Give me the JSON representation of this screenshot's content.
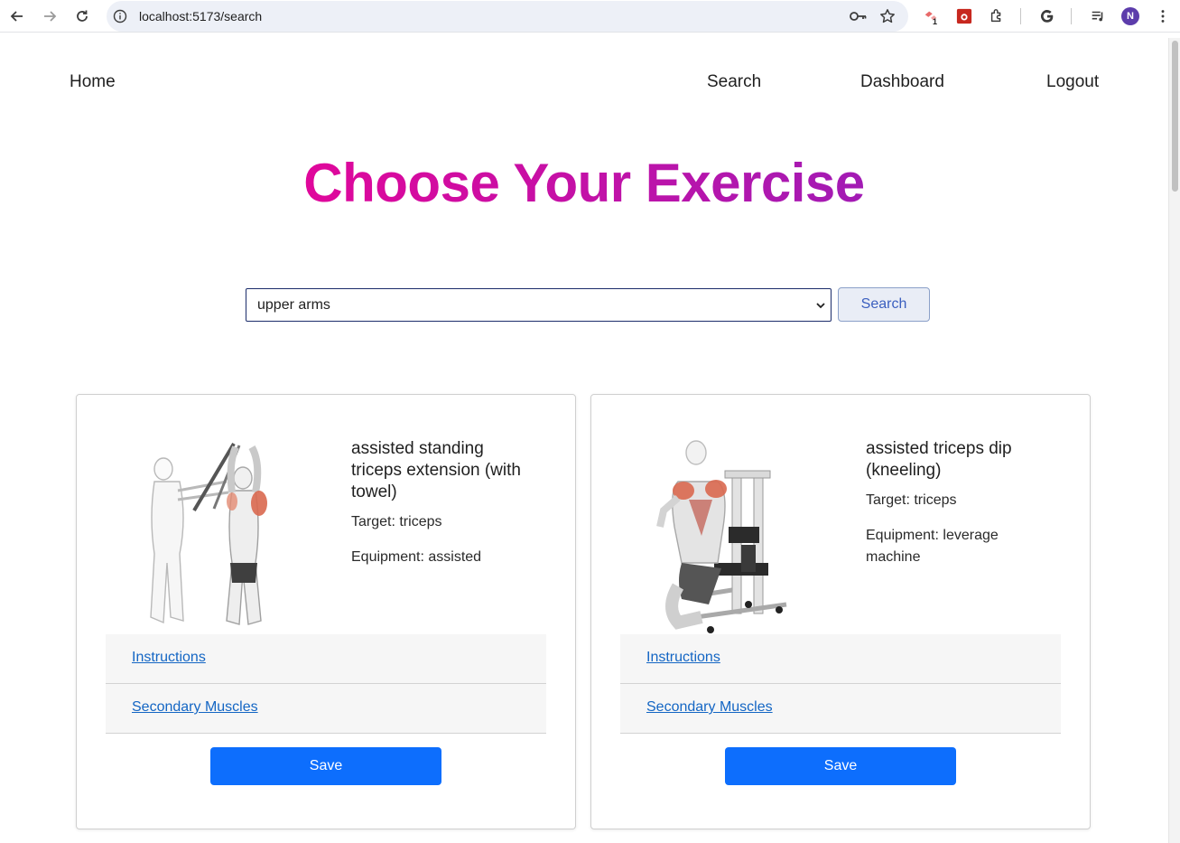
{
  "browser": {
    "url": "localhost:5173/search",
    "extension_badge": "1",
    "profile_initial": "N"
  },
  "nav": {
    "home": "Home",
    "search": "Search",
    "dashboard": "Dashboard",
    "logout": "Logout"
  },
  "page": {
    "title": "Choose Your Exercise",
    "select_value": "upper arms",
    "search_button": "Search"
  },
  "cards": [
    {
      "name": "assisted standing triceps extension (with towel)",
      "target": "Target: triceps",
      "equipment": "Equipment: assisted",
      "instructions": "Instructions",
      "secondary": "Secondary Muscles",
      "save": "Save"
    },
    {
      "name": "assisted triceps dip (kneeling)",
      "target": "Target: triceps",
      "equipment": "Equipment: leverage machine",
      "instructions": "Instructions",
      "secondary": "Secondary Muscles",
      "save": "Save"
    }
  ],
  "colors": {
    "title_gradient_start": "#e0079b",
    "title_gradient_end": "#a21bb4",
    "save_button": "#0d6efd",
    "link": "#1466c4"
  }
}
